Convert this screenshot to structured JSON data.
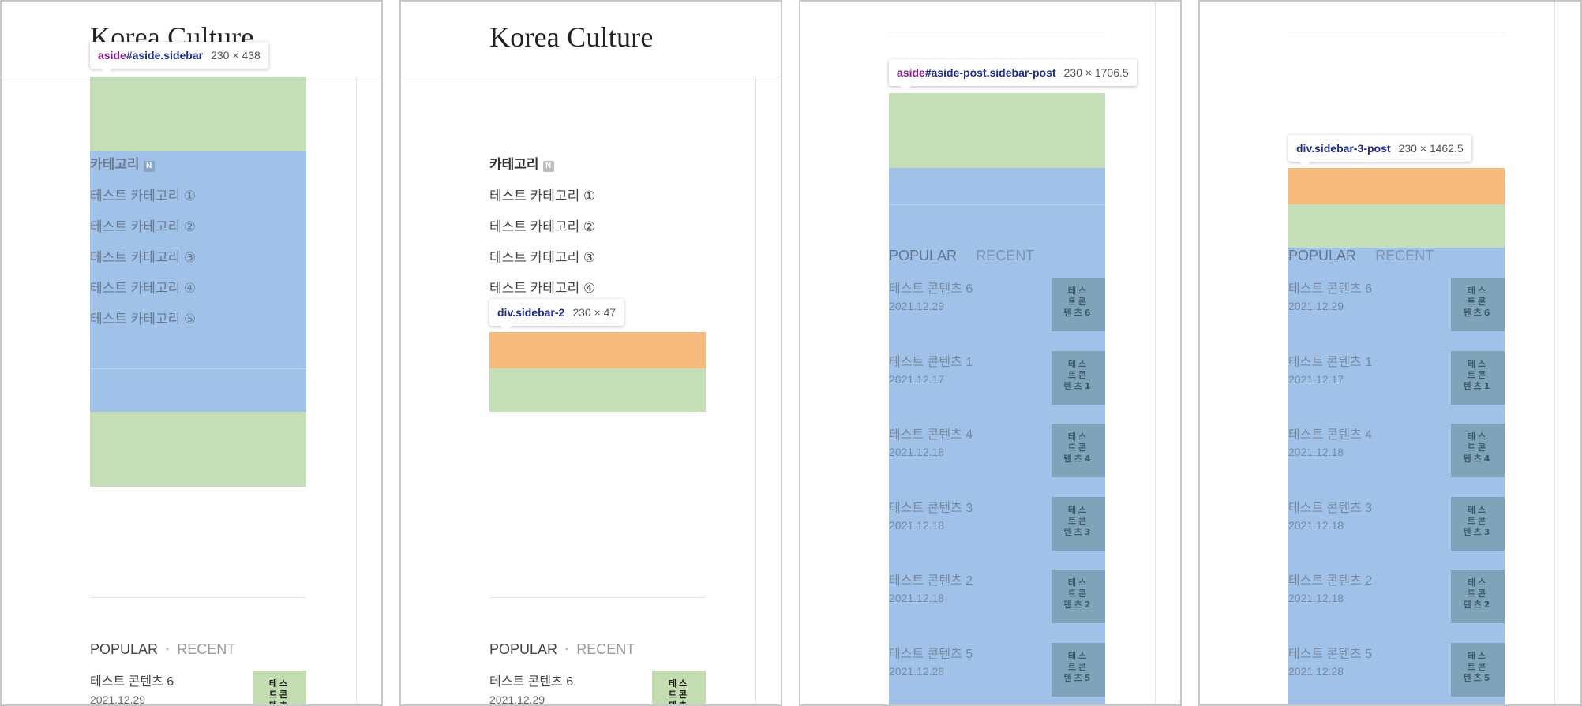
{
  "site_title": "Korea Culture",
  "category": {
    "heading": "카테고리",
    "new_badge": "N",
    "items": [
      "테스트 카테고리 ①",
      "테스트 카테고리 ②",
      "테스트 카테고리 ③",
      "테스트 카테고리 ④",
      "테스트 카테고리 ⑤"
    ]
  },
  "tabs": {
    "popular": "POPULAR",
    "recent": "RECENT"
  },
  "posts": [
    {
      "title": "테스트 콘텐츠 6",
      "date": "2021.12.29",
      "thumb": "테스트콘텐츠6"
    },
    {
      "title": "테스트 콘텐츠 1",
      "date": "2021.12.17",
      "thumb": "테스트콘텐츠1"
    },
    {
      "title": "테스트 콘텐츠 4",
      "date": "2021.12.18",
      "thumb": "테스트콘텐츠4"
    },
    {
      "title": "테스트 콘텐츠 3",
      "date": "2021.12.18",
      "thumb": "테스트콘텐츠3"
    },
    {
      "title": "테스트 콘텐츠 2",
      "date": "2021.12.18",
      "thumb": "테스트콘텐츠2"
    },
    {
      "title": "테스트 콘텐츠 5",
      "date": "2021.12.28",
      "thumb": "테스트콘텐츠5"
    }
  ],
  "thumb_partial": "테스트콘텐츠",
  "tooltips": {
    "aside_sidebar": {
      "tag": "aside",
      "selector": "#aside.sidebar",
      "size": "230 × 438"
    },
    "sidebar_2": {
      "selector": "div.sidebar-2",
      "size": "230 × 47"
    },
    "aside_post": {
      "tag": "aside",
      "selector": "#aside-post.sidebar-post",
      "size": "230 × 1706.5"
    },
    "sidebar_3_post": {
      "selector": "div.sidebar-3-post",
      "size": "230 × 1462.5"
    }
  },
  "colors": {
    "overlay_margin": "#a4ce91",
    "overlay_content": "#78a8e0",
    "overlay_padding": "#f6b26b",
    "tooltip_tag": "#8a1f8e",
    "tooltip_class": "#1f2d8a"
  }
}
